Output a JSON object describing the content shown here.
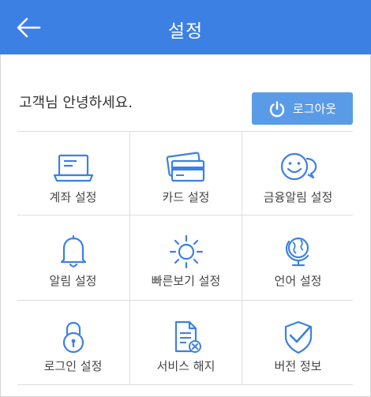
{
  "header": {
    "back_icon": "arrow-left-icon",
    "title": "설정"
  },
  "greeting": "고객님 안녕하세요.",
  "logout": {
    "icon": "power-icon",
    "label": "로그아웃"
  },
  "menu": [
    {
      "label": "계좌 설정",
      "icon": "laptop-icon"
    },
    {
      "label": "카드 설정",
      "icon": "credit-card-icon"
    },
    {
      "label": "금융알림 설정",
      "icon": "chat-smile-icon"
    },
    {
      "label": "알림 설정",
      "icon": "bell-icon"
    },
    {
      "label": "빠른보기 설정",
      "icon": "sun-icon"
    },
    {
      "label": "언어 설정",
      "icon": "globe-icon"
    },
    {
      "label": "로그인 설정",
      "icon": "lock-icon"
    },
    {
      "label": "서비스 해지",
      "icon": "document-cancel-icon"
    },
    {
      "label": "버전 정보",
      "icon": "shield-check-icon"
    }
  ],
  "colors": {
    "header": "#3d80e3",
    "button": "#5a9be8",
    "icon": "#3d80e3"
  }
}
